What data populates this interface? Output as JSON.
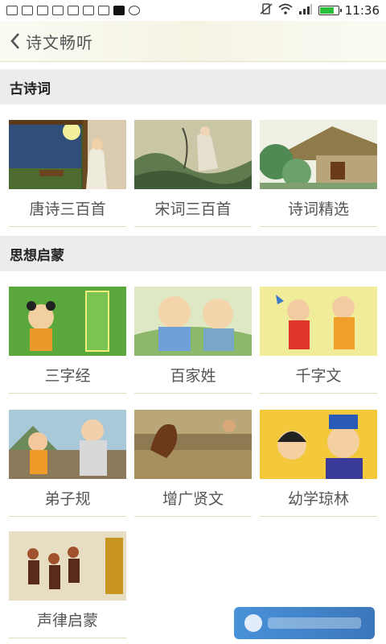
{
  "status_bar": {
    "time": "11:36"
  },
  "nav": {
    "title": "诗文畅听"
  },
  "sections": [
    {
      "title": "古诗词",
      "items": [
        {
          "label": "唐诗三百首",
          "thumb": "poet-moon-scene"
        },
        {
          "label": "宋词三百首",
          "thumb": "lady-garden-scene"
        },
        {
          "label": "诗词精选",
          "thumb": "thatched-hut-scene"
        }
      ]
    },
    {
      "title": "思想启蒙",
      "items": [
        {
          "label": "三字经",
          "thumb": "child-scroll-scene"
        },
        {
          "label": "百家姓",
          "thumb": "two-children-scene"
        },
        {
          "label": "千字文",
          "thumb": "costumed-kids-scene"
        },
        {
          "label": "弟子规",
          "thumb": "boy-elder-scene"
        },
        {
          "label": "增广贤文",
          "thumb": "rooster-yard-scene"
        },
        {
          "label": "幼学琼林",
          "thumb": "scholar-girl-scene"
        },
        {
          "label": "声律启蒙",
          "thumb": "dancers-scene"
        }
      ]
    }
  ]
}
